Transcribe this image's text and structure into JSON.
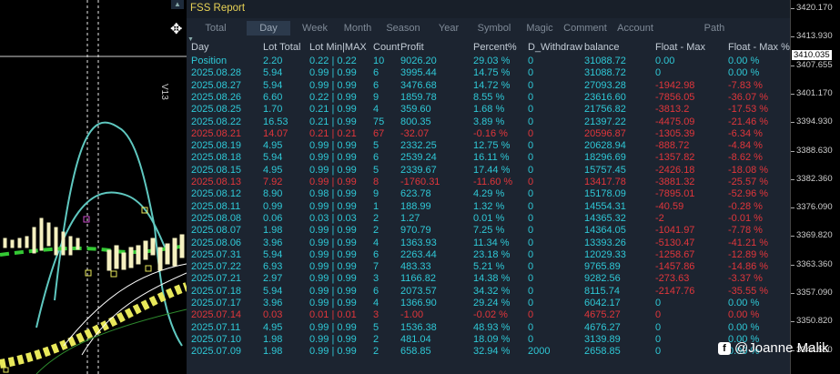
{
  "window": {
    "title": "FSS Report",
    "symbol_tag": "V13"
  },
  "tabs": [
    {
      "label": "Total"
    },
    {
      "label": "Day",
      "active": true
    },
    {
      "label": "Week"
    },
    {
      "label": "Month"
    },
    {
      "label": "Season"
    },
    {
      "label": "Year"
    },
    {
      "label": "Symbol"
    },
    {
      "label": "Magic"
    },
    {
      "label": "Comment"
    },
    {
      "label": "Account"
    },
    {
      "label": "Path"
    }
  ],
  "columns": [
    "Day",
    "Lot Total",
    "Lot Min|MAX",
    "Count",
    "Profit",
    "Percent%",
    "D_Withdraw",
    "balance",
    "Float - Max",
    "Float - Max %"
  ],
  "rows": [
    {
      "day": "Position",
      "lot": "2.20",
      "minmax": "0.22 | 0.22",
      "count": "10",
      "profit": "9026.20",
      "pct": "29.03 %",
      "wd": "0",
      "bal": "31088.72",
      "fmax": "0.00",
      "fmaxp": "0.00 %",
      "neg": false
    },
    {
      "day": "2025.08.28",
      "lot": "5.94",
      "minmax": "0.99 | 0.99",
      "count": "6",
      "profit": "3995.44",
      "pct": "14.75 %",
      "wd": "0",
      "bal": "31088.72",
      "fmax": "0",
      "fmaxp": "0.00 %",
      "neg": false
    },
    {
      "day": "2025.08.27",
      "lot": "5.94",
      "minmax": "0.99 | 0.99",
      "count": "6",
      "profit": "3476.68",
      "pct": "14.72 %",
      "wd": "0",
      "bal": "27093.28",
      "fmax": "-1942.98",
      "fmaxp": "-7.83 %",
      "neg": false
    },
    {
      "day": "2025.08.26",
      "lot": "6.60",
      "minmax": "0.22 | 0.99",
      "count": "9",
      "profit": "1859.78",
      "pct": "8.55 %",
      "wd": "0",
      "bal": "23616.60",
      "fmax": "-7856.05",
      "fmaxp": "-36.07 %",
      "neg": false
    },
    {
      "day": "2025.08.25",
      "lot": "1.70",
      "minmax": "0.21 | 0.99",
      "count": "4",
      "profit": "359.60",
      "pct": "1.68 %",
      "wd": "0",
      "bal": "21756.82",
      "fmax": "-3813.2",
      "fmaxp": "-17.53 %",
      "neg": false
    },
    {
      "day": "2025.08.22",
      "lot": "16.53",
      "minmax": "0.21 | 0.99",
      "count": "75",
      "profit": "800.35",
      "pct": "3.89 %",
      "wd": "0",
      "bal": "21397.22",
      "fmax": "-4475.09",
      "fmaxp": "-21.46 %",
      "neg": false
    },
    {
      "day": "2025.08.21",
      "lot": "14.07",
      "minmax": "0.21 | 0.21",
      "count": "67",
      "profit": "-32.07",
      "pct": "-0.16 %",
      "wd": "0",
      "bal": "20596.87",
      "fmax": "-1305.39",
      "fmaxp": "-6.34 %",
      "neg": true
    },
    {
      "day": "2025.08.19",
      "lot": "4.95",
      "minmax": "0.99 | 0.99",
      "count": "5",
      "profit": "2332.25",
      "pct": "12.75 %",
      "wd": "0",
      "bal": "20628.94",
      "fmax": "-888.72",
      "fmaxp": "-4.84 %",
      "neg": false
    },
    {
      "day": "2025.08.18",
      "lot": "5.94",
      "minmax": "0.99 | 0.99",
      "count": "6",
      "profit": "2539.24",
      "pct": "16.11 %",
      "wd": "0",
      "bal": "18296.69",
      "fmax": "-1357.82",
      "fmaxp": "-8.62 %",
      "neg": false
    },
    {
      "day": "2025.08.15",
      "lot": "4.95",
      "minmax": "0.99 | 0.99",
      "count": "5",
      "profit": "2339.67",
      "pct": "17.44 %",
      "wd": "0",
      "bal": "15757.45",
      "fmax": "-2426.18",
      "fmaxp": "-18.08 %",
      "neg": false
    },
    {
      "day": "2025.08.13",
      "lot": "7.92",
      "minmax": "0.99 | 0.99",
      "count": "8",
      "profit": "-1760.31",
      "pct": "-11.60 %",
      "wd": "0",
      "bal": "13417.78",
      "fmax": "-3881.32",
      "fmaxp": "-25.57 %",
      "neg": true
    },
    {
      "day": "2025.08.12",
      "lot": "8.90",
      "minmax": "0.98 | 0.99",
      "count": "9",
      "profit": "623.78",
      "pct": "4.29 %",
      "wd": "0",
      "bal": "15178.09",
      "fmax": "-7895.01",
      "fmaxp": "-52.96 %",
      "neg": false
    },
    {
      "day": "2025.08.11",
      "lot": "0.99",
      "minmax": "0.99 | 0.99",
      "count": "1",
      "profit": "188.99",
      "pct": "1.32 %",
      "wd": "0",
      "bal": "14554.31",
      "fmax": "-40.59",
      "fmaxp": "-0.28 %",
      "neg": false
    },
    {
      "day": "2025.08.08",
      "lot": "0.06",
      "minmax": "0.03 | 0.03",
      "count": "2",
      "profit": "1.27",
      "pct": "0.01 %",
      "wd": "0",
      "bal": "14365.32",
      "fmax": "-2",
      "fmaxp": "-0.01 %",
      "neg": false
    },
    {
      "day": "2025.08.07",
      "lot": "1.98",
      "minmax": "0.99 | 0.99",
      "count": "2",
      "profit": "970.79",
      "pct": "7.25 %",
      "wd": "0",
      "bal": "14364.05",
      "fmax": "-1041.97",
      "fmaxp": "-7.78 %",
      "neg": false
    },
    {
      "day": "2025.08.06",
      "lot": "3.96",
      "minmax": "0.99 | 0.99",
      "count": "4",
      "profit": "1363.93",
      "pct": "11.34 %",
      "wd": "0",
      "bal": "13393.26",
      "fmax": "-5130.47",
      "fmaxp": "-41.21 %",
      "neg": false
    },
    {
      "day": "2025.07.31",
      "lot": "5.94",
      "minmax": "0.99 | 0.99",
      "count": "6",
      "profit": "2263.44",
      "pct": "23.18 %",
      "wd": "0",
      "bal": "12029.33",
      "fmax": "-1258.67",
      "fmaxp": "-12.89 %",
      "neg": false
    },
    {
      "day": "2025.07.22",
      "lot": "6.93",
      "minmax": "0.99 | 0.99",
      "count": "7",
      "profit": "483.33",
      "pct": "5.21 %",
      "wd": "0",
      "bal": "9765.89",
      "fmax": "-1457.86",
      "fmaxp": "-14.86 %",
      "neg": false
    },
    {
      "day": "2025.07.21",
      "lot": "2.97",
      "minmax": "0.99 | 0.99",
      "count": "3",
      "profit": "1166.82",
      "pct": "14.38 %",
      "wd": "0",
      "bal": "9282.56",
      "fmax": "-273.63",
      "fmaxp": "-3.37 %",
      "neg": false
    },
    {
      "day": "2025.07.18",
      "lot": "5.94",
      "minmax": "0.99 | 0.99",
      "count": "6",
      "profit": "2073.57",
      "pct": "34.32 %",
      "wd": "0",
      "bal": "8115.74",
      "fmax": "-2147.76",
      "fmaxp": "-35.55 %",
      "neg": false
    },
    {
      "day": "2025.07.17",
      "lot": "3.96",
      "minmax": "0.99 | 0.99",
      "count": "4",
      "profit": "1366.90",
      "pct": "29.24 %",
      "wd": "0",
      "bal": "6042.17",
      "fmax": "0",
      "fmaxp": "0.00 %",
      "neg": false
    },
    {
      "day": "2025.07.14",
      "lot": "0.03",
      "minmax": "0.01 | 0.01",
      "count": "3",
      "profit": "-1.00",
      "pct": "-0.02 %",
      "wd": "0",
      "bal": "4675.27",
      "fmax": "0",
      "fmaxp": "0.00 %",
      "neg": true
    },
    {
      "day": "2025.07.11",
      "lot": "4.95",
      "minmax": "0.99 | 0.99",
      "count": "5",
      "profit": "1536.38",
      "pct": "48.93 %",
      "wd": "0",
      "bal": "4676.27",
      "fmax": "0",
      "fmaxp": "0.00 %",
      "neg": false
    },
    {
      "day": "2025.07.10",
      "lot": "1.98",
      "minmax": "0.99 | 0.99",
      "count": "2",
      "profit": "481.04",
      "pct": "18.09 %",
      "wd": "0",
      "bal": "3139.89",
      "fmax": "0",
      "fmaxp": "0.00 %",
      "neg": false
    },
    {
      "day": "2025.07.09",
      "lot": "1.98",
      "minmax": "0.99 | 0.99",
      "count": "2",
      "profit": "658.85",
      "pct": "32.94 %",
      "wd": "2000",
      "bal": "2658.85",
      "fmax": "0",
      "fmaxp": "0.00 %",
      "neg": false
    }
  ],
  "price_axis": {
    "ticks": [
      "3420.170",
      "3413.930",
      "3407.655",
      "3401.170",
      "3394.930",
      "3388.630",
      "3382.360",
      "3376.090",
      "3369.820",
      "3363.360",
      "3357.090",
      "3350.820",
      "3344.550"
    ],
    "current_price": "3410.035"
  },
  "watermark": {
    "text": "@Joanne Malik"
  },
  "colors": {
    "positive": "#2fc8d6",
    "negative": "#e0363b",
    "title": "#e8d256",
    "panel_bg": "#1c2430"
  }
}
